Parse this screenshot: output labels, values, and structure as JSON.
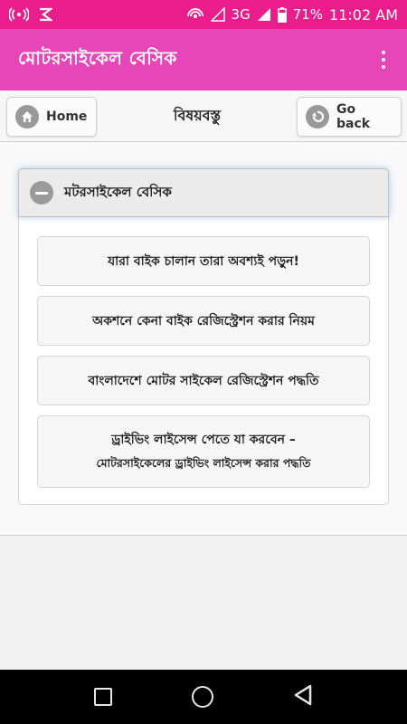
{
  "status_bar": {
    "network": "3G",
    "battery": "71%",
    "time": "11:02 AM"
  },
  "app_bar": {
    "title": "মোটরসাইকেল বেসিক"
  },
  "toolbar": {
    "home_label": "Home",
    "title": "বিষয়বস্তু",
    "back_label": "Go back"
  },
  "section": {
    "title": "মটরসাইকেল বেসিক",
    "items": [
      {
        "label": "যারা বাইক চালান তারা অবশ্যই পড়ুন!"
      },
      {
        "label": "অকশনে কেনা বাইক রেজিস্ট্রেশন করার নিয়ম"
      },
      {
        "label": "বাংলাদেশে মোটর সাইকেল রেজিস্ট্রেশন পদ্ধতি"
      },
      {
        "label": "ড্রাইভিং লাইসেন্স পেতে যা করবেন –",
        "sub": "মোটরসাইকেলের ড্রাইভিং লাইসেন্স করার পদ্ধতি"
      }
    ]
  },
  "colors": {
    "status_bar": "#e91e8c",
    "app_bar": "#e846b8"
  },
  "icons": {
    "status_left": [
      "hotspot-icon",
      "notification-icon"
    ],
    "status_right": [
      "wifi-icon",
      "signal-icon",
      "battery-icon"
    ],
    "home": "home-icon",
    "back": "back-arrow-icon",
    "collapse": "minus-icon",
    "nav": [
      "recents-icon",
      "home-circle-icon",
      "back-triangle-icon"
    ]
  }
}
